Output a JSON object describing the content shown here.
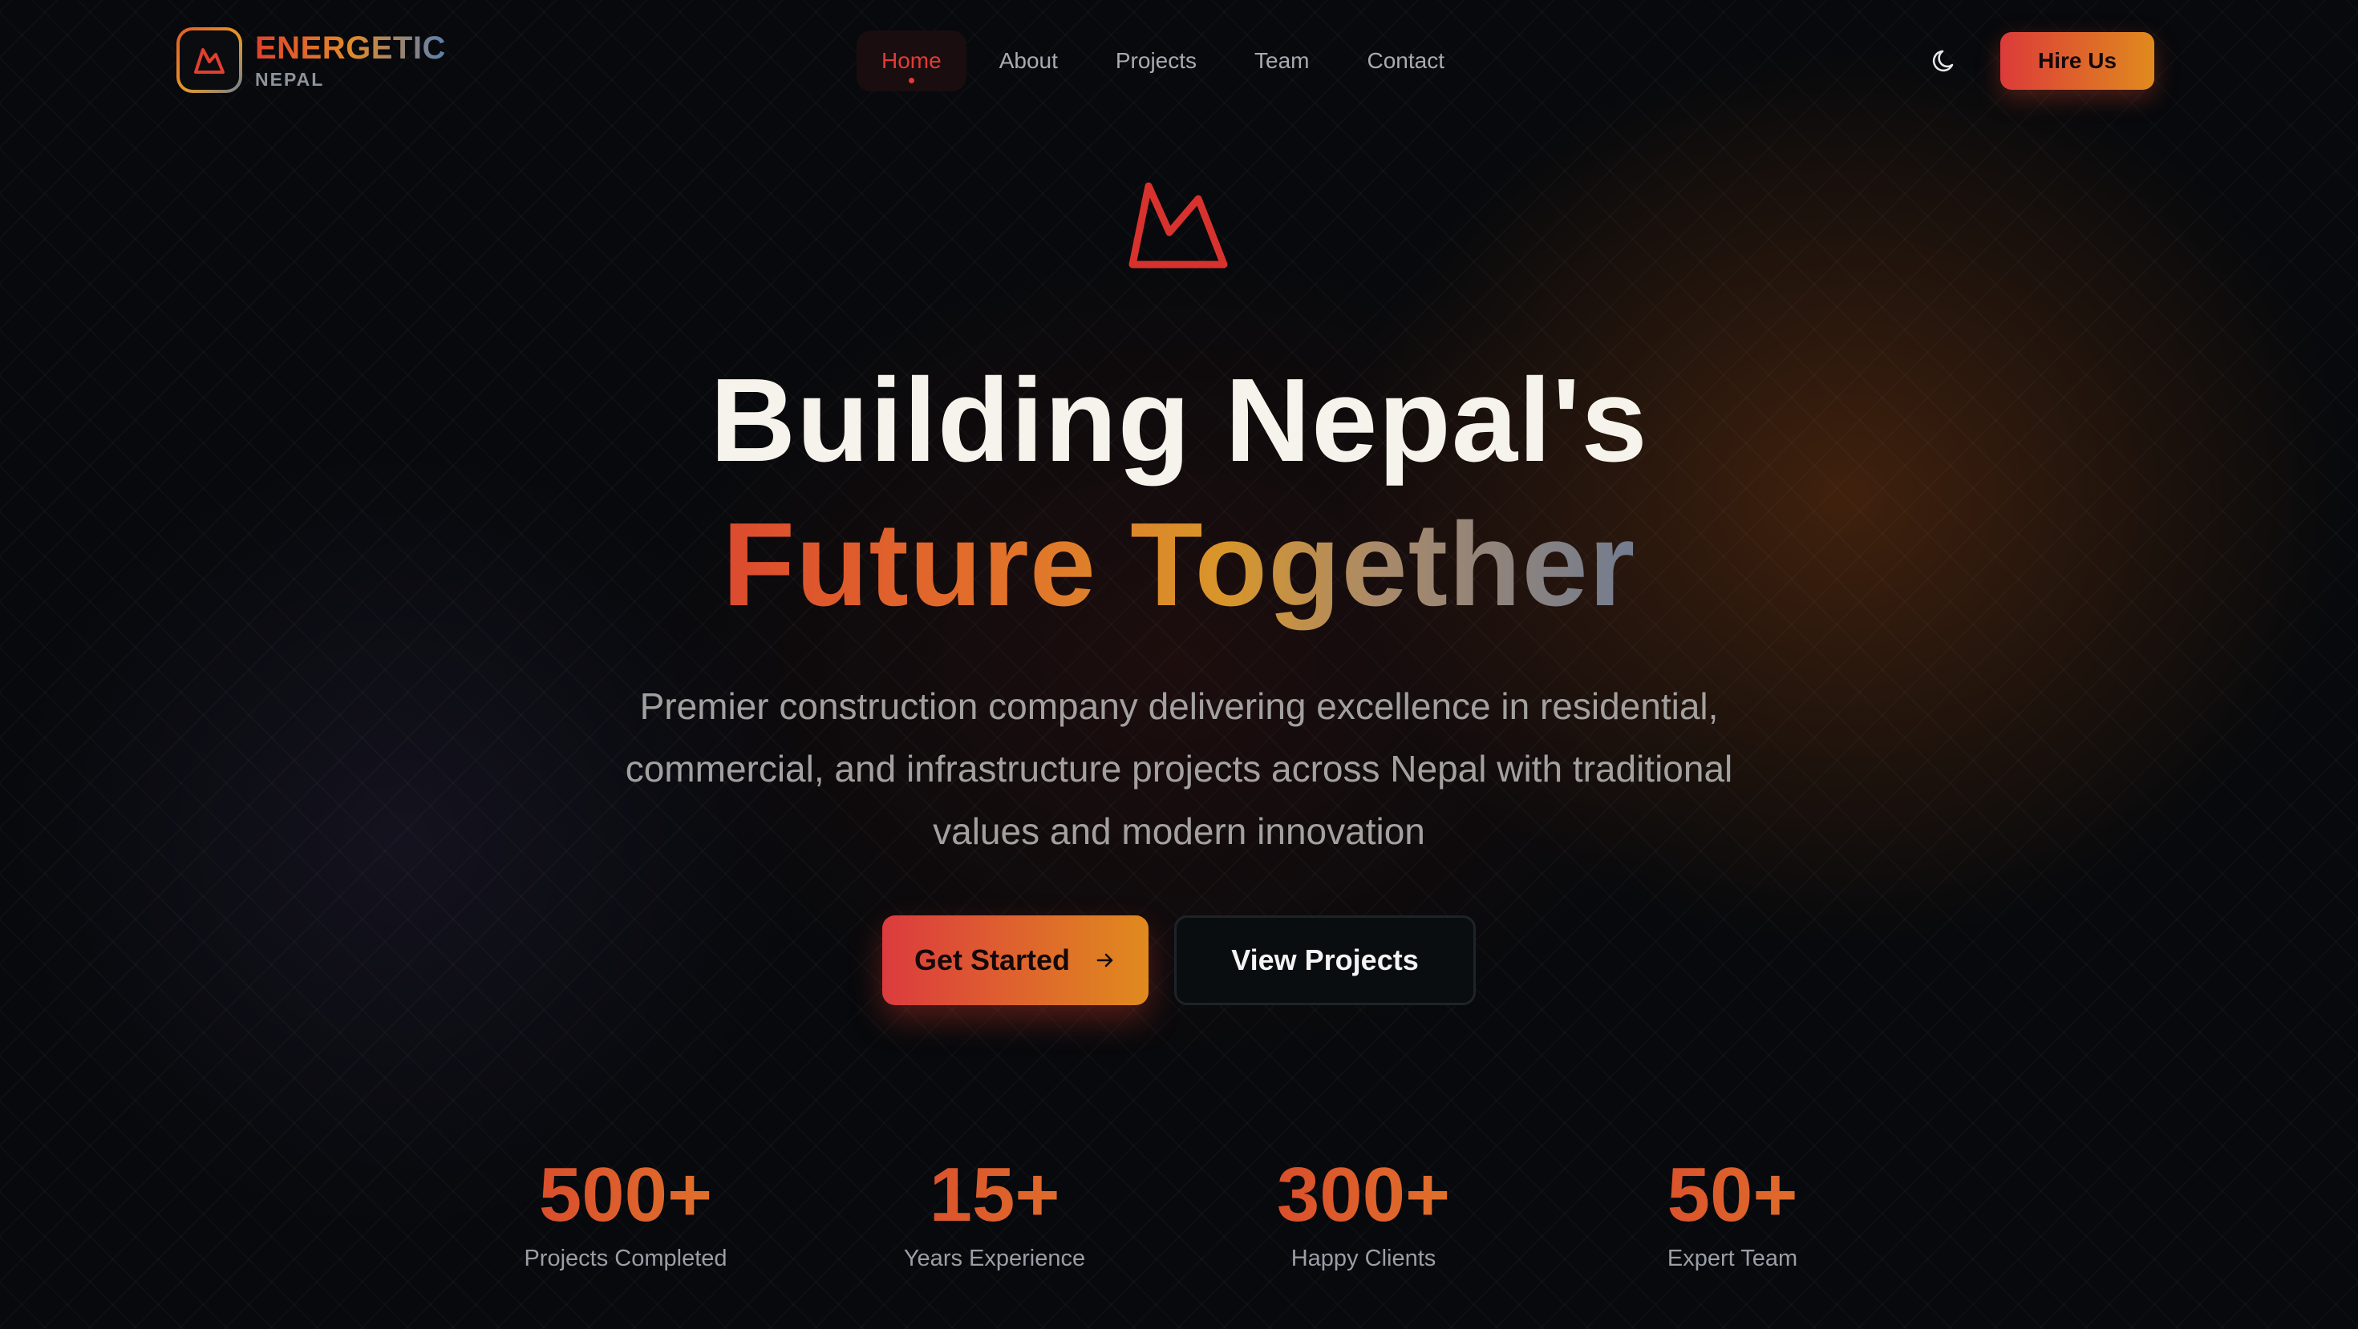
{
  "brand": {
    "name": "ENERGETIC",
    "sub": "NEPAL",
    "logo_icon": "mountain-icon",
    "colors": {
      "accent_red": "#dc3b39",
      "accent_orange": "#e08a1e",
      "background": "#07090c"
    }
  },
  "nav": {
    "items": [
      {
        "label": "Home",
        "active": true
      },
      {
        "label": "About",
        "active": false
      },
      {
        "label": "Projects",
        "active": false
      },
      {
        "label": "Team",
        "active": false
      },
      {
        "label": "Contact",
        "active": false
      }
    ],
    "theme_toggle_icon": "moon-icon",
    "cta_label": "Hire Us"
  },
  "hero": {
    "icon": "mountain-icon",
    "title_line1": "Building Nepal's",
    "title_line2": "Future Together",
    "subtitle": "Premier construction company delivering excellence in residential, commercial, and infrastructure projects across Nepal with traditional values and modern innovation",
    "primary_button": "Get Started",
    "primary_button_icon": "arrow-right-icon",
    "secondary_button": "View Projects"
  },
  "stats": [
    {
      "value": "500+",
      "label": "Projects Completed"
    },
    {
      "value": "15+",
      "label": "Years Experience"
    },
    {
      "value": "300+",
      "label": "Happy Clients"
    },
    {
      "value": "50+",
      "label": "Expert Team"
    }
  ]
}
